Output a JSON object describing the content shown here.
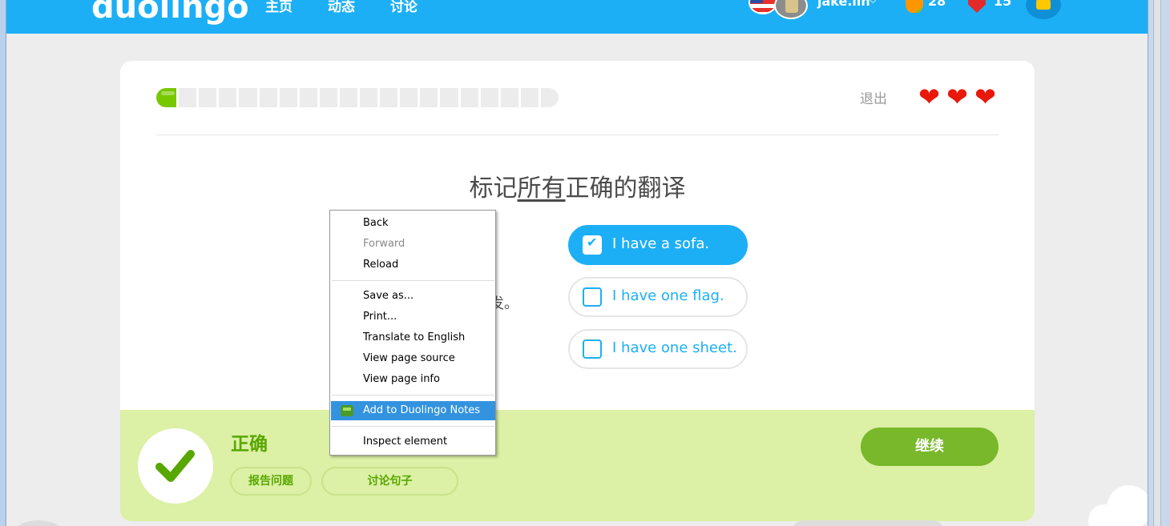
{
  "header": {
    "logo": "duolingo",
    "nav": {
      "home": "主页",
      "activity": "动态",
      "discuss": "讨论"
    },
    "username": "jake.lin",
    "user_chevron": "⌵",
    "streak_count": "28",
    "gem_count": "15",
    "icons": {
      "flag": "us-flag-icon",
      "avatar": "avatar",
      "streak": "streak-flame-icon",
      "gems": "gem-icon",
      "notifications": "bell-icon"
    }
  },
  "lesson": {
    "progress": 0.05,
    "quit_label": "退出",
    "hearts": [
      "❤",
      "❤",
      "❤"
    ],
    "prompt_prefix": "标记",
    "prompt_emphasis": "所有",
    "prompt_suffix": "正确的翻译",
    "sentence_fragment": "发。",
    "options": [
      {
        "label": "I have a sofa.",
        "checked": true
      },
      {
        "label": "I have one flag.",
        "checked": false
      },
      {
        "label": "I have one sheet.",
        "checked": false
      }
    ],
    "checkmark": "✔"
  },
  "feedback": {
    "title": "正确",
    "report_label": "报告问题",
    "discuss_label": "讨论句子",
    "continue_label": "继续"
  },
  "context_menu": {
    "back": "Back",
    "forward": "Forward",
    "reload": "Reload",
    "save_as": "Save as...",
    "print": "Print...",
    "translate": "Translate to English",
    "view_source": "View page source",
    "view_info": "View page info",
    "add_notes": "Add to Duolingo Notes",
    "inspect": "Inspect element"
  },
  "colors": {
    "brand_blue": "#1caff6",
    "success_green": "#58a700",
    "footer_green": "#dcf0a6",
    "continue_green": "#78b82a",
    "heart_red": "#e8180a",
    "menu_highlight": "#3393df"
  }
}
